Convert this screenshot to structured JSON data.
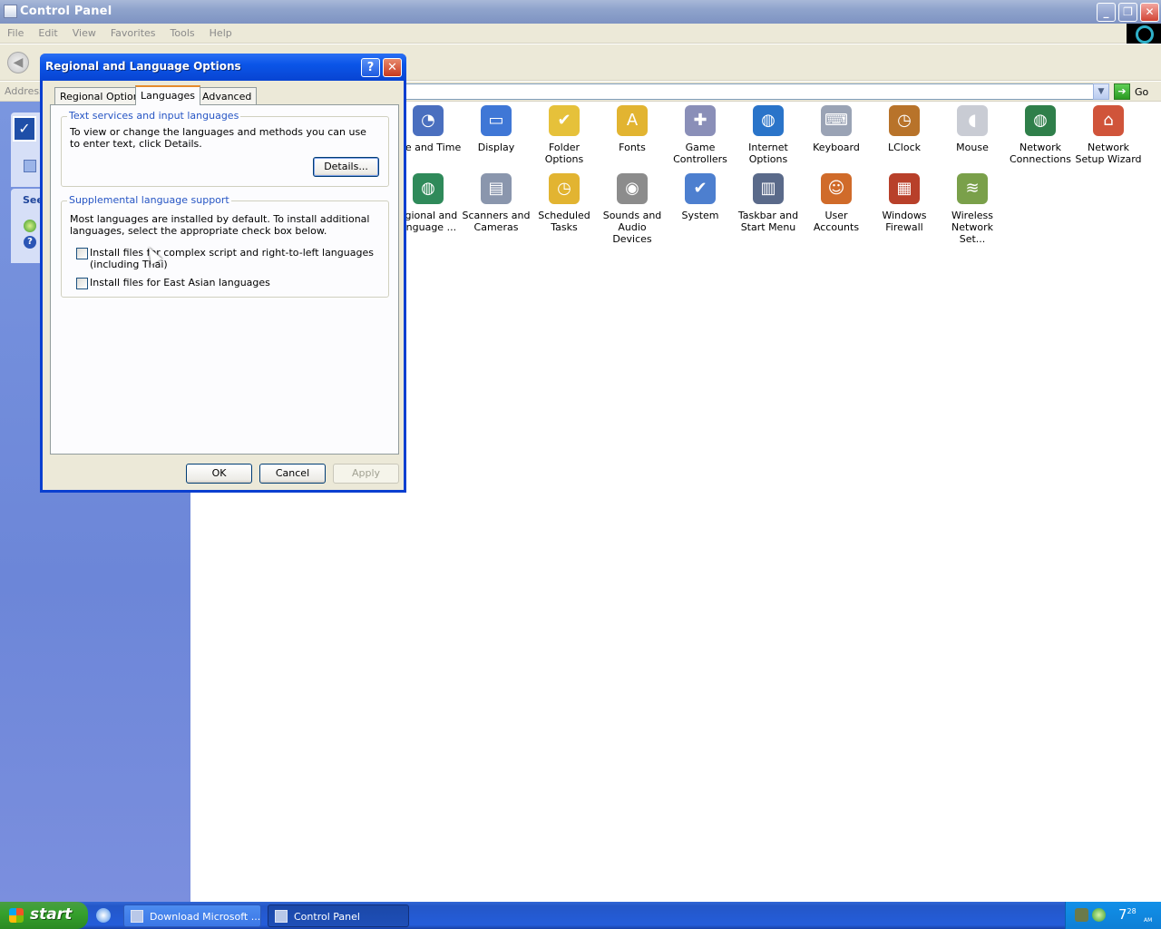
{
  "window": {
    "title": "Control Panel",
    "menu": [
      "File",
      "Edit",
      "View",
      "Favorites",
      "Tools",
      "Help"
    ],
    "address_label": "Address",
    "go_label": "Go",
    "taskpane_heading": "See"
  },
  "icons": [
    {
      "label": "ate and Time",
      "glyph": "clock-icon",
      "color": "#4a6fbf",
      "ch": "◔"
    },
    {
      "label": "Display",
      "glyph": "display-icon",
      "color": "#3f77d6",
      "ch": "▭"
    },
    {
      "label": "Folder Options",
      "glyph": "folder-options-icon",
      "color": "#e6c13a",
      "ch": "✔"
    },
    {
      "label": "Fonts",
      "glyph": "fonts-folder-icon",
      "color": "#e2b431",
      "ch": "A"
    },
    {
      "label": "Game Controllers",
      "glyph": "gamepad-icon",
      "color": "#8a8fb8",
      "ch": "✚"
    },
    {
      "label": "Internet Options",
      "glyph": "globe-icon",
      "color": "#2a74c9",
      "ch": "◍"
    },
    {
      "label": "Keyboard",
      "glyph": "keyboard-icon",
      "color": "#9aa3b5",
      "ch": "⌨"
    },
    {
      "label": "LClock",
      "glyph": "lclock-icon",
      "color": "#b8732a",
      "ch": "◷"
    },
    {
      "label": "Mouse",
      "glyph": "mouse-icon",
      "color": "#c9ccd4",
      "ch": "◖"
    },
    {
      "label": "Network Connections",
      "glyph": "network-globe-icon",
      "color": "#2f7f4a",
      "ch": "◍"
    },
    {
      "label": "Network Setup Wizard",
      "glyph": "network-house-icon",
      "color": "#d0543a",
      "ch": "⌂"
    },
    {
      "label": "egional and anguage ...",
      "glyph": "regional-globe-icon",
      "color": "#2f8a5a",
      "ch": "◍"
    },
    {
      "label": "Scanners and Cameras",
      "glyph": "scanner-icon",
      "color": "#8a96ad",
      "ch": "▤"
    },
    {
      "label": "Scheduled Tasks",
      "glyph": "scheduled-folder-icon",
      "color": "#e2b431",
      "ch": "◷"
    },
    {
      "label": "Sounds and Audio Devices",
      "glyph": "speaker-icon",
      "color": "#8c8c8c",
      "ch": "◉"
    },
    {
      "label": "System",
      "glyph": "system-icon",
      "color": "#4d7fcf",
      "ch": "✔"
    },
    {
      "label": "Taskbar and Start Menu",
      "glyph": "taskbar-icon",
      "color": "#5a6a8a",
      "ch": "▥"
    },
    {
      "label": "User Accounts",
      "glyph": "users-icon",
      "color": "#d06b2a",
      "ch": "☺"
    },
    {
      "label": "Windows Firewall",
      "glyph": "firewall-icon",
      "color": "#b8402a",
      "ch": "▦"
    },
    {
      "label": "Wireless Network Set...",
      "glyph": "wireless-icon",
      "color": "#7aa04a",
      "ch": "≋"
    }
  ],
  "dialog": {
    "title": "Regional and Language Options",
    "tabs": [
      "Regional Options",
      "Languages",
      "Advanced"
    ],
    "group1": {
      "legend": "Text services and input languages",
      "desc": "To view or change the languages and methods you can use to enter text, click Details.",
      "details_button": "Details..."
    },
    "group2": {
      "legend": "Supplemental language support",
      "desc": "Most languages are installed by default. To install additional languages, select the appropriate check box below.",
      "check1": "Install files for complex script and right-to-left languages (including Thai)",
      "check2": "Install files for East Asian languages",
      "check1_checked": false,
      "check2_checked": false
    },
    "ok": "OK",
    "cancel": "Cancel",
    "apply": "Apply"
  },
  "taskbar": {
    "start": "start",
    "buttons": [
      "Download Microsoft ....",
      "Control Panel"
    ],
    "clock": "7",
    "clock_minutes": "28",
    "clock_ampm": "AM"
  }
}
